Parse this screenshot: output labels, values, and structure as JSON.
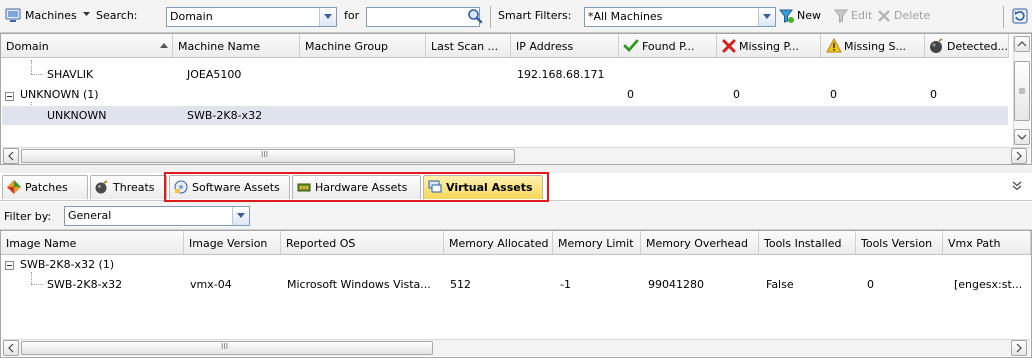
{
  "toolbar": {
    "machines_label": "Machines",
    "search_label": "Search:",
    "search_value": "Domain",
    "for_label": "for",
    "for_value": "",
    "smart_filters_label": "Smart Filters:",
    "smart_filters_value": "*All Machines",
    "new_label": "New",
    "edit_label": "Edit",
    "delete_label": "Delete"
  },
  "machines_grid": {
    "columns": [
      "Domain",
      "Machine Name",
      "Machine Group",
      "Last Scan ...",
      "IP Address",
      "Found P...",
      "Missing P...",
      "Missing S...",
      "Detected..."
    ],
    "rows": [
      {
        "domain": "SHAVLIK",
        "machine_name": "JOEA5100",
        "ip": "192.168.68.171"
      },
      {
        "domain": "UNKNOWN (1)",
        "found": "0",
        "missing_p": "0",
        "missing_s": "0",
        "detected": "0"
      },
      {
        "domain": "UNKNOWN",
        "machine_name": "SWB-2K8-x32"
      }
    ],
    "scroll_grip": "III"
  },
  "tabs": [
    {
      "label": "Patches",
      "icon": "patches-diamond-icon"
    },
    {
      "label": "Threats",
      "icon": "threats-icon"
    },
    {
      "label": "Software Assets",
      "icon": "software-assets-icon"
    },
    {
      "label": "Hardware Assets",
      "icon": "hardware-assets-icon"
    },
    {
      "label": "Virtual Assets",
      "icon": "virtual-assets-icon",
      "active": true
    }
  ],
  "filter": {
    "label": "Filter by:",
    "value": "General"
  },
  "assets_grid": {
    "columns": [
      "Image Name",
      "Image Version",
      "Reported OS",
      "Memory Allocated",
      "Memory Limit",
      "Memory Overhead",
      "Tools Installed",
      "Tools Version",
      "Vmx Path"
    ],
    "group": "SWB-2K8-x32 (1)",
    "row": {
      "image_name": "SWB-2K8-x32",
      "image_version": "vmx-04",
      "reported_os": "Microsoft Windows Vista...",
      "memory_allocated": "512",
      "memory_limit": "-1",
      "memory_overhead": "99041280",
      "tools_installed": "False",
      "tools_version": "0",
      "vmx_path": "[engesx:st..."
    },
    "scroll_grip": "III"
  },
  "colors": {
    "highlight": "#e01b1b",
    "active_tab": "#f7d75a",
    "selected_row": "#dfe3ee"
  }
}
